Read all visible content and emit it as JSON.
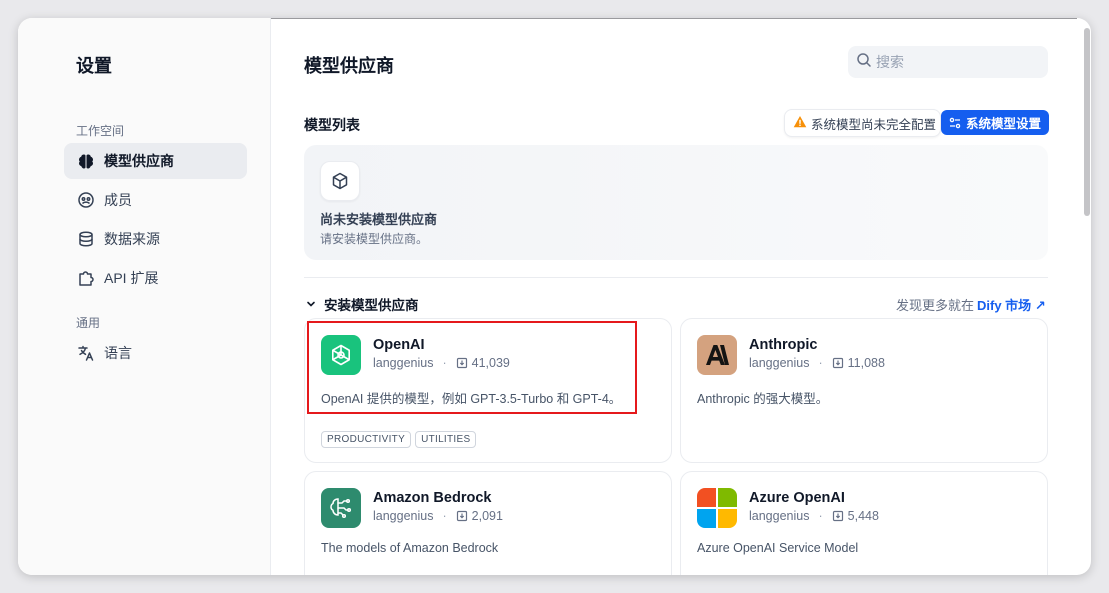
{
  "sidebar": {
    "title": "设置",
    "section_workspace": "工作空间",
    "section_general": "通用",
    "items": [
      {
        "label": "模型供应商",
        "icon": "brain-icon",
        "active": true
      },
      {
        "label": "成员",
        "icon": "members-icon",
        "active": false
      },
      {
        "label": "数据来源",
        "icon": "database-icon",
        "active": false
      },
      {
        "label": "API 扩展",
        "icon": "puzzle-icon",
        "active": false
      },
      {
        "label": "语言",
        "icon": "translate-icon",
        "active": false
      }
    ]
  },
  "header": {
    "title": "模型供应商",
    "search_placeholder": "搜索"
  },
  "model_list": {
    "title": "模型列表",
    "warning": "系统模型尚未完全配置",
    "system_settings_button": "系统模型设置",
    "empty_title": "尚未安装模型供应商",
    "empty_subtitle": "请安装模型供应商。"
  },
  "install": {
    "title": "安装模型供应商",
    "discover_prefix": "发现更多就在",
    "discover_link": "Dify 市场",
    "link_arrow": "↗"
  },
  "providers": [
    {
      "name": "OpenAI",
      "author": "langgenius",
      "installs": "41,039",
      "description": "OpenAI 提供的模型，例如 GPT-3.5-Turbo 和 GPT-4。",
      "tags": [
        "PRODUCTIVITY",
        "UTILITIES"
      ],
      "logo_color": "#19c37d"
    },
    {
      "name": "Anthropic",
      "author": "langgenius",
      "installs": "11,088",
      "description": "Anthropic 的强大模型。",
      "tags": [],
      "logo_color": "#d4a27f"
    },
    {
      "name": "Amazon Bedrock",
      "author": "langgenius",
      "installs": "2,091",
      "description": "The models of Amazon Bedrock",
      "tags": [],
      "logo_color": "#2e8b6e"
    },
    {
      "name": "Azure OpenAI",
      "author": "langgenius",
      "installs": "5,448",
      "description": "Azure OpenAI Service Model",
      "tags": [],
      "logo_color": "#f25022"
    }
  ],
  "colors": {
    "primary": "#155eef",
    "warning": "#f79009",
    "highlight": "#e5191c"
  }
}
